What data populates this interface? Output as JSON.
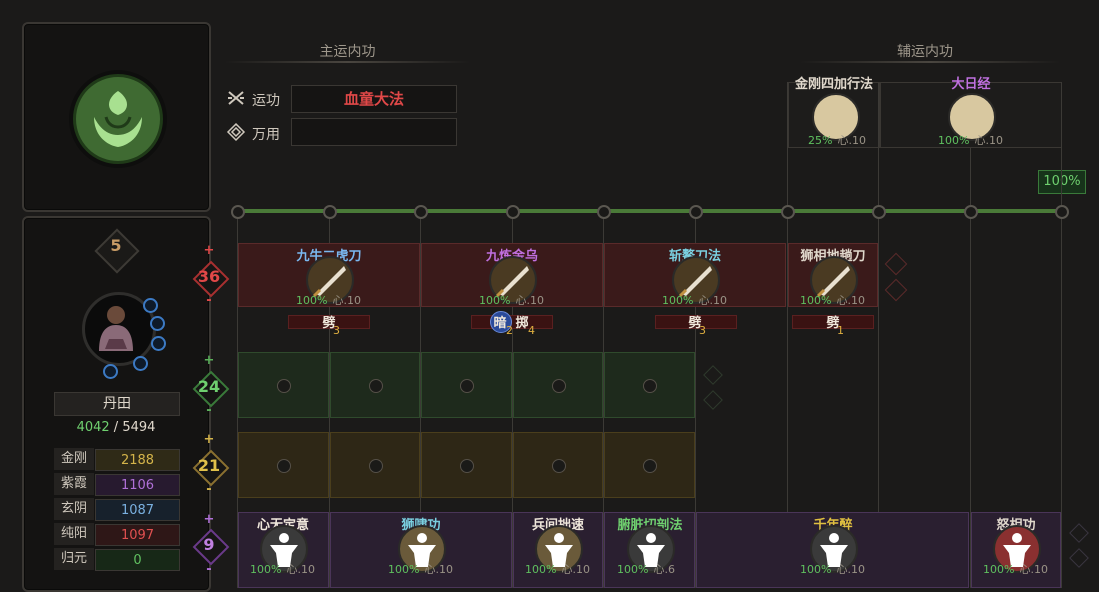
{
  "character": {
    "level": "5",
    "dantian_label": "丹田",
    "dantian_current": "4042",
    "dantian_sep": " / ",
    "dantian_max": "5494",
    "stats": [
      {
        "name": "金刚",
        "value": "2188",
        "color": "#d4b44a",
        "bg": "#2f2a17"
      },
      {
        "name": "紫霞",
        "value": "1106",
        "color": "#b070d8",
        "bg": "#271a2f"
      },
      {
        "name": "玄阴",
        "value": "1087",
        "color": "#7ab0e0",
        "bg": "#17212c"
      },
      {
        "name": "纯阳",
        "value": "1097",
        "color": "#e05050",
        "bg": "#2e1717"
      },
      {
        "name": "归元",
        "value": "0",
        "color": "#60c060",
        "bg": "#172817"
      }
    ]
  },
  "columns": {
    "red": {
      "value": "36",
      "color": "#e04848"
    },
    "green": {
      "value": "24",
      "color": "#5ab05a"
    },
    "yellow": {
      "value": "21",
      "color": "#d4b44a"
    },
    "purple": {
      "value": "9",
      "color": "#b070d8"
    },
    "plus": "+",
    "minus": "-"
  },
  "main_section": {
    "title": "主运内功",
    "yungong_label": "运功",
    "yungong_value": "血童大法",
    "wanyong_label": "万用",
    "wanyong_value": ""
  },
  "aux_section": {
    "title": "辅运内功",
    "skills": [
      {
        "name": "金刚四加行法",
        "pct": "25%",
        "heart": "心.10",
        "color": "#e0d8cc"
      },
      {
        "name": "大日经",
        "pct": "100%",
        "heart": "心.10",
        "color": "#c070e0"
      }
    ],
    "ratio": "100%"
  },
  "red_skills": [
    {
      "name": "九牛二虎刀",
      "pct": "100%",
      "heart": "心.10",
      "color": "#7ab8f0",
      "tag": "劈",
      "tag_num": "3"
    },
    {
      "name": "九炼金乌",
      "pct": "100%",
      "heart": "心.10",
      "color": "#c070e0",
      "tag": "掷",
      "tag_num": "4",
      "tag2": "暗",
      "tag2_num": "2"
    },
    {
      "name": "斩鳌刀法",
      "pct": "100%",
      "heart": "心.10",
      "color": "#7ad0e0",
      "tag": "劈",
      "tag_num": "3"
    },
    {
      "name": "狮相地趟刀",
      "pct": "100%",
      "heart": "心.10",
      "color": "#e0d8cc",
      "tag": "劈",
      "tag_num": "1"
    }
  ],
  "purple_skills": [
    {
      "name": "心无定意",
      "pct": "100%",
      "heart": "心.10",
      "color": "#f0e8dc"
    },
    {
      "name": "狮啸功",
      "pct": "100%",
      "heart": "心.10",
      "color": "#7ad0e0"
    },
    {
      "name": "兵间拙速",
      "pct": "100%",
      "heart": "心.10",
      "color": "#f0e8dc"
    },
    {
      "name": "腑脏切剖法",
      "pct": "100%",
      "heart": "心.6",
      "color": "#6fd06f"
    },
    {
      "name": "千年醉",
      "pct": "100%",
      "heart": "心.10",
      "color": "#e0c040"
    },
    {
      "name": "怒相功",
      "pct": "100%",
      "heart": "心.10",
      "color": "#e0d8cc"
    }
  ]
}
